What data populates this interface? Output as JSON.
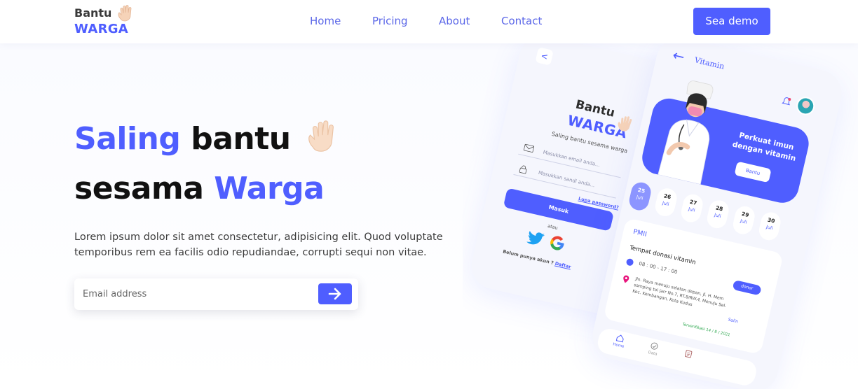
{
  "brand": {
    "name_top": "Bantu",
    "name_bottom": "WARGA",
    "hand_icon": "waving-hand-icon"
  },
  "nav": {
    "links": [
      {
        "label": "Home"
      },
      {
        "label": "Pricing"
      },
      {
        "label": "About"
      },
      {
        "label": "Contact"
      }
    ],
    "cta_label": "Sea demo"
  },
  "hero": {
    "title_line1_accent": "Saling",
    "title_line1_rest": "bantu",
    "title_line2_rest": "sesama",
    "title_line2_accent": "Warga",
    "description": "Lorem ipsum dolor sit amet consectetur, adipisicing elit. Quod voluptate temporibus rem ea facilis odio repudiandae, corrupti sequi non vitae.",
    "email_placeholder": "Email address",
    "submit_icon": "arrow-right-icon"
  },
  "login_phone": {
    "back": "<",
    "logo_top": "Bantu",
    "logo_bottom": "WARGA",
    "tagline": "Saling bantu sesama warga",
    "email_placeholder": "Masukkan email anda...",
    "password_placeholder": "Masukkan sandi anda...",
    "forgot": "Lupa password?",
    "login_button": "Masuk",
    "or": "atau",
    "register_text": "Belum punya akun ?",
    "register_link": "Daftar"
  },
  "vitamin_phone": {
    "back": "←",
    "title": "Vitamin",
    "banner_text": "Perkuat imun dengan vitamin",
    "banner_button": "Bantu",
    "dates": [
      {
        "day": "25",
        "month": "Juli",
        "active": true
      },
      {
        "day": "26",
        "month": "Juli",
        "active": false
      },
      {
        "day": "27",
        "month": "Juli",
        "active": false
      },
      {
        "day": "28",
        "month": "Juli",
        "active": false
      },
      {
        "day": "29",
        "month": "Juli",
        "active": false
      },
      {
        "day": "30",
        "month": "Juli",
        "active": false
      }
    ],
    "card": {
      "org": "PMII",
      "event": "Tempat donasi vitamin",
      "time": "08 : 00 - 17 : 00",
      "tag": "donor",
      "address": "Jln. Raya menuju selatan depan, Jl. H. Mem samping toi jarr No.7, RT.8/RW.4, Menuju Sel. Kec. Kembangan, Kota Kudus",
      "copy": "Salin",
      "verified": "Terverifikasi 14 / 8 / 2021"
    },
    "bottom_nav": [
      {
        "label": "Home"
      },
      {
        "label": "Data"
      },
      {
        "label": ""
      }
    ]
  },
  "colors": {
    "accent": "#4f5eff",
    "heading": "#111111",
    "body_text": "#3c3c3c"
  }
}
